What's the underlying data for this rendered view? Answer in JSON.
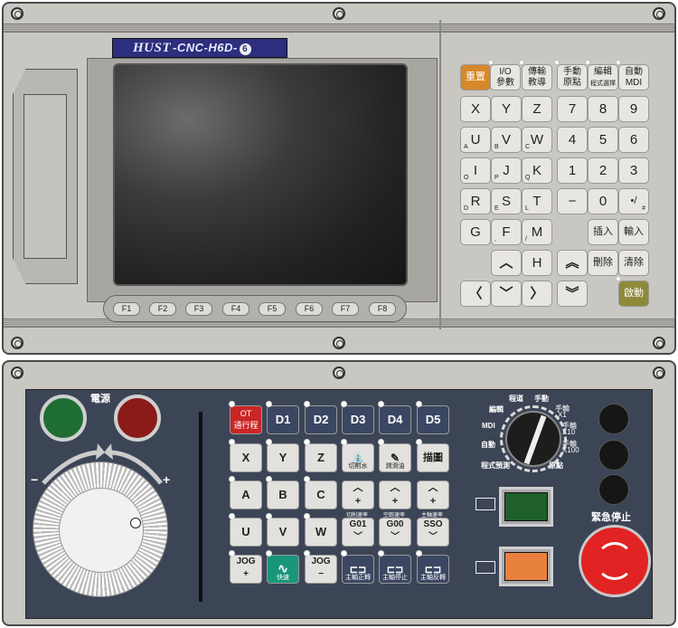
{
  "brand": {
    "logo": "HUST",
    "model": "-CNC-H6D-",
    "version": "6"
  },
  "function_keys": [
    "F1",
    "F2",
    "F3",
    "F4",
    "F5",
    "F6",
    "F7",
    "F8"
  ],
  "keypad": {
    "reset": "重置",
    "io_params": [
      "I/O",
      "參數"
    ],
    "teach": [
      "傳輸",
      "教導"
    ],
    "manual_home": [
      "手動",
      "原點"
    ],
    "edit": [
      "編輯",
      "程式選擇"
    ],
    "auto_mdi": [
      "自動",
      "MDI"
    ],
    "row1": [
      "X",
      "Y",
      "Z",
      "7",
      "8",
      "9"
    ],
    "row2": [
      {
        "k": "U",
        "s": "A"
      },
      {
        "k": "V",
        "s": "B"
      },
      {
        "k": "W",
        "s": "C"
      },
      {
        "k": "4"
      },
      {
        "k": "5"
      },
      {
        "k": "6"
      }
    ],
    "row3": [
      {
        "k": "I",
        "s": "O"
      },
      {
        "k": "J",
        "s": "P"
      },
      {
        "k": "K",
        "s": "Q"
      },
      {
        "k": "1"
      },
      {
        "k": "2"
      },
      {
        "k": "3"
      }
    ],
    "row4": [
      {
        "k": "R",
        "s": "D"
      },
      {
        "k": "S",
        "s": "E"
      },
      {
        "k": "T",
        "s": "L"
      },
      {
        "k": "−"
      },
      {
        "k": "0"
      },
      {
        "k": "•/",
        "s": "#"
      }
    ],
    "g_key": "G",
    "f_key": "F",
    "m_key": "M",
    "insert": "插入",
    "input": "輸入",
    "h_key": "H",
    "delete": "刪除",
    "clear": "清除",
    "start": "啟動",
    "arrow_up": "︿",
    "arrow_down": "﹀",
    "arrow_left": "〈",
    "arrow_right": "〉",
    "page_up": "︽",
    "page_down": "︾",
    "comma": ","
  },
  "operator": {
    "power_label": "電源",
    "ot_key": [
      "OT",
      "通行程"
    ],
    "d_keys": [
      "D1",
      "D2",
      "D3",
      "D4",
      "D5"
    ],
    "axis_row1": [
      "X",
      "Y",
      "Z"
    ],
    "coolant": "切削水",
    "lube": "潤滑油",
    "graph": "描圖",
    "axis_row2": [
      "A",
      "B",
      "C"
    ],
    "override_caps": [
      "切削速率",
      "空跑速率",
      "主軸速率"
    ],
    "axis_row3": [
      "U",
      "V",
      "W"
    ],
    "g_modes": [
      "G01",
      "G00",
      "SSO"
    ],
    "jog_plus": [
      "JOG",
      "+"
    ],
    "rapid": "快速",
    "jog_minus": [
      "JOG",
      "−"
    ],
    "spindle": [
      "主軸正轉",
      "主軸停止",
      "主軸反轉"
    ],
    "mode_dial_labels": [
      "程道",
      "手動",
      "手輪",
      "X1",
      "手輪",
      "X10",
      "手輪",
      "X100",
      "原點",
      "程式預測",
      "自動",
      "MDI",
      "編輯"
    ],
    "emergency_stop": "緊急停止",
    "handwheel_minus": "−",
    "handwheel_plus": "+"
  },
  "colors": {
    "panel": "#c9c7c2",
    "operator_bg": "#3c4556",
    "reset_key": "#d6892a",
    "start_key": "#8f8a3a",
    "green_lamp": "#1f6e33",
    "red_lamp": "#8a1b18",
    "estop": "#e12323",
    "cycle_start_green": "#1e5f2b",
    "feed_hold_orange": "#e7813d"
  }
}
